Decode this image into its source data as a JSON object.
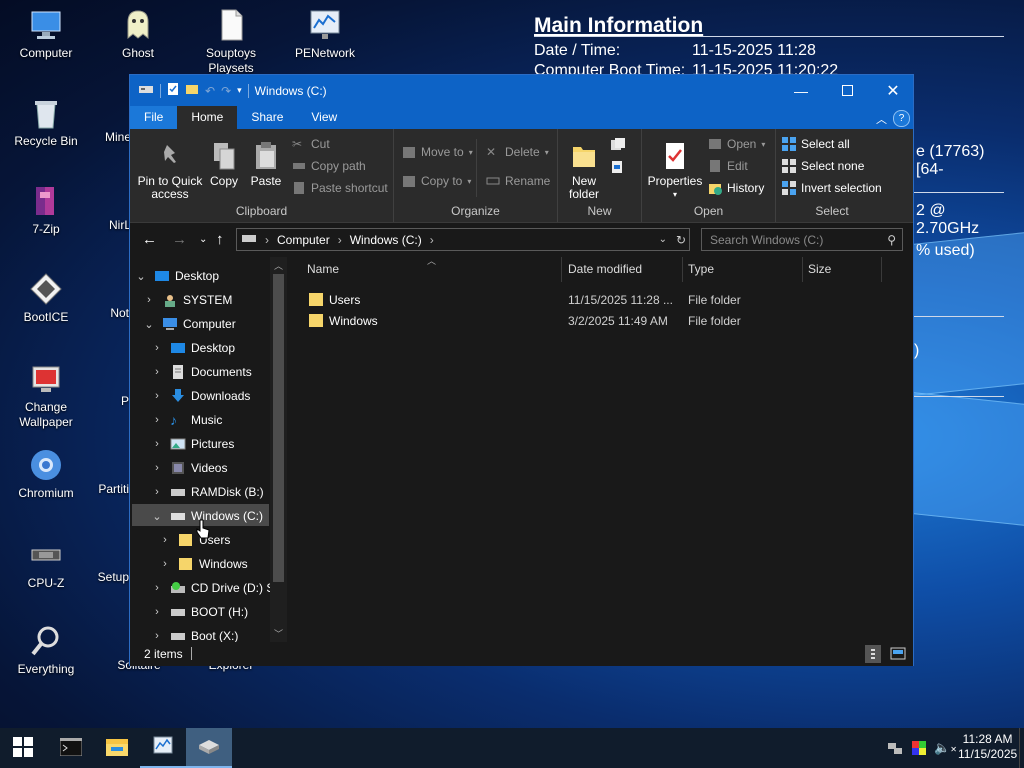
{
  "desktop": {
    "icons": [
      {
        "label": "Computer",
        "icon": "computer-icon"
      },
      {
        "label": "Recycle Bin",
        "icon": "recycle-bin-icon"
      },
      {
        "label": "7-Zip",
        "icon": "7zip-icon"
      },
      {
        "label": "BootICE",
        "icon": "bootice-icon"
      },
      {
        "label": "Change Wallpaper",
        "icon": "wallpaper-icon"
      },
      {
        "label": "Chromium",
        "icon": "chromium-icon"
      },
      {
        "label": "CPU-Z",
        "icon": "cpuz-icon"
      },
      {
        "label": "Everything",
        "icon": "everything-icon"
      },
      {
        "label": "Ghost",
        "icon": "ghost-icon"
      },
      {
        "label": "Mine",
        "icon": "minesweeper-icon"
      },
      {
        "label": "NirL",
        "icon": "nirlauncher-icon"
      },
      {
        "label": "Not",
        "icon": "notepad-icon"
      },
      {
        "label": "P",
        "icon": "p-icon"
      },
      {
        "label": "Partiti",
        "icon": "partition-icon"
      },
      {
        "label": "Setup",
        "icon": "setup-icon"
      },
      {
        "label": "Solitaire",
        "icon": "solitaire-icon"
      },
      {
        "label": "Souptoys Playsets",
        "icon": "document-icon"
      },
      {
        "label": "Explorer",
        "icon": "explorer-icon"
      },
      {
        "label": "PENetwork",
        "icon": "penetwork-icon"
      }
    ]
  },
  "info_panel": {
    "title": "Main Information",
    "date_label": "Date / Time:",
    "date_value": "11-15-2025 11:28",
    "boot_label": "Computer Boot Time:",
    "boot_value": "11-15-2025 11:20:22",
    "os_fragment": "e (17763) [64-",
    "cpu_fragment": "2 @ 2.70GHz",
    "mem_fragment": "% used)",
    "misc_fragment": ")"
  },
  "window": {
    "title": "Windows (C:)",
    "tabs": [
      "File",
      "Home",
      "Share",
      "View"
    ],
    "active_tab": "Home",
    "ribbon": {
      "clipboard": {
        "name": "Clipboard",
        "pin": "Pin to Quick access",
        "copy": "Copy",
        "paste": "Paste",
        "cut": "Cut",
        "copy_path": "Copy path",
        "paste_shortcut": "Paste shortcut"
      },
      "organize": {
        "name": "Organize",
        "move_to": "Move to",
        "copy_to": "Copy to",
        "delete": "Delete",
        "rename": "Rename"
      },
      "new": {
        "name": "New",
        "new_folder": "New folder"
      },
      "open": {
        "name": "Open",
        "properties": "Properties",
        "open": "Open",
        "edit": "Edit",
        "history": "History"
      },
      "select": {
        "name": "Select",
        "select_all": "Select all",
        "select_none": "Select none",
        "invert": "Invert selection"
      }
    },
    "address": {
      "segments": [
        "Computer",
        "Windows (C:)"
      ]
    },
    "search": {
      "placeholder": "Search Windows (C:)"
    },
    "nav_tree": [
      {
        "label": "Desktop",
        "level": 0,
        "expanded": true
      },
      {
        "label": "SYSTEM",
        "level": 1,
        "expanded": false
      },
      {
        "label": "Computer",
        "level": 1,
        "expanded": true
      },
      {
        "label": "Desktop",
        "level": 2,
        "expanded": false
      },
      {
        "label": "Documents",
        "level": 2,
        "expanded": false
      },
      {
        "label": "Downloads",
        "level": 2,
        "expanded": false
      },
      {
        "label": "Music",
        "level": 2,
        "expanded": false
      },
      {
        "label": "Pictures",
        "level": 2,
        "expanded": false
      },
      {
        "label": "Videos",
        "level": 2,
        "expanded": false
      },
      {
        "label": "RAMDisk (B:)",
        "level": 2,
        "expanded": false
      },
      {
        "label": "Windows (C:)",
        "level": 2,
        "expanded": true,
        "selected": true
      },
      {
        "label": "Users",
        "level": 3,
        "expanded": false
      },
      {
        "label": "Windows",
        "level": 3,
        "expanded": false
      },
      {
        "label": "CD Drive (D:) S",
        "level": 2,
        "expanded": false
      },
      {
        "label": "BOOT (H:)",
        "level": 2,
        "expanded": false
      },
      {
        "label": "Boot (X:)",
        "level": 2,
        "expanded": false
      }
    ],
    "columns": [
      "Name",
      "Date modified",
      "Type",
      "Size"
    ],
    "files": [
      {
        "name": "Users",
        "date": "11/15/2025 11:28 ...",
        "type": "File folder",
        "size": ""
      },
      {
        "name": "Windows",
        "date": "3/2/2025 11:49 AM",
        "type": "File folder",
        "size": ""
      }
    ],
    "status": {
      "items": "2 items"
    }
  },
  "taskbar": {
    "time": "11:28 AM",
    "date": "11/15/2025"
  }
}
